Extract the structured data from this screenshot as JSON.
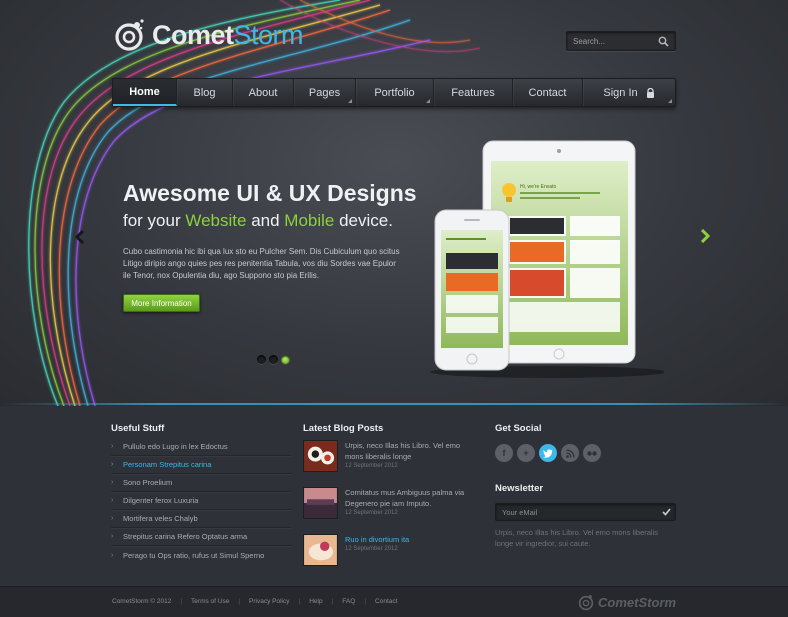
{
  "brand": {
    "name_part1": "Comet",
    "name_part2": "Storm"
  },
  "search": {
    "placeholder": "Search..."
  },
  "nav": {
    "items": [
      {
        "label": "Home"
      },
      {
        "label": "Blog"
      },
      {
        "label": "About"
      },
      {
        "label": "Pages"
      },
      {
        "label": "Portfolio"
      },
      {
        "label": "Features"
      },
      {
        "label": "Contact"
      },
      {
        "label": "Sign In"
      }
    ]
  },
  "hero": {
    "title": "Awesome UI & UX Designs",
    "sub_prefix": "for your ",
    "sub_highlight1": "Website",
    "sub_middle": " and ",
    "sub_highlight2": "Mobile",
    "sub_suffix": " device.",
    "description": "Cubo castimonia hic ibi qua lux sto eu Pulcher Sem. Dis Cubiculum quo scitus Litigo diripio ango quies pes res penitentia Tabula, vos diu Sordes vae Epulor ile Tenor, nox Opulentia diu, ago Suppono sto pia Erilis.",
    "button_label": "More Information",
    "tablet_greeting": "Hi, we're Envato"
  },
  "useful": {
    "title": "Useful Stuff",
    "items": [
      "Pullulo edo Lugo in lex Edoctus",
      "Personam Strepitus carina",
      "Sono Proelium",
      "Dilgenter ferox Luxuria",
      "Mortifera veles Chalyb",
      "Strepitus carina Refero Optatus arma",
      "Perago tu Ops ratio, rufus ut Simul Sperno"
    ]
  },
  "blog": {
    "title": "Latest Blog Posts",
    "posts": [
      {
        "title": "Urpis, neco Illas his Libro. Vel emo mons liberalis longe",
        "date": "12 September 2012"
      },
      {
        "title": "Comitatus mus Ambiguus palma via Degenero pie iam Imputo.",
        "date": "12 September 2012"
      },
      {
        "title": "Ruo in divortium ita",
        "date": "12 September 2012"
      }
    ]
  },
  "social": {
    "title": "Get Social",
    "icons": [
      "facebook-icon",
      "google-plus-icon",
      "twitter-icon",
      "rss-icon",
      "flickr-icon"
    ]
  },
  "newsletter": {
    "title": "Newsletter",
    "placeholder": "Your eMail",
    "text": "Urpis, neco Illas his Libro. Vel emo mons liberalis longe vir ingredior, sui caute."
  },
  "footer": {
    "copyright": "CometStorm © 2012",
    "links": [
      "Terms of Use",
      "Privacy Policy",
      "Help",
      "FAQ",
      "Contact"
    ],
    "logo_text": "CometStorm"
  },
  "colors": {
    "accent_blue": "#3fb7e8",
    "accent_green": "#8cd23c",
    "background": "#2c2f36"
  }
}
